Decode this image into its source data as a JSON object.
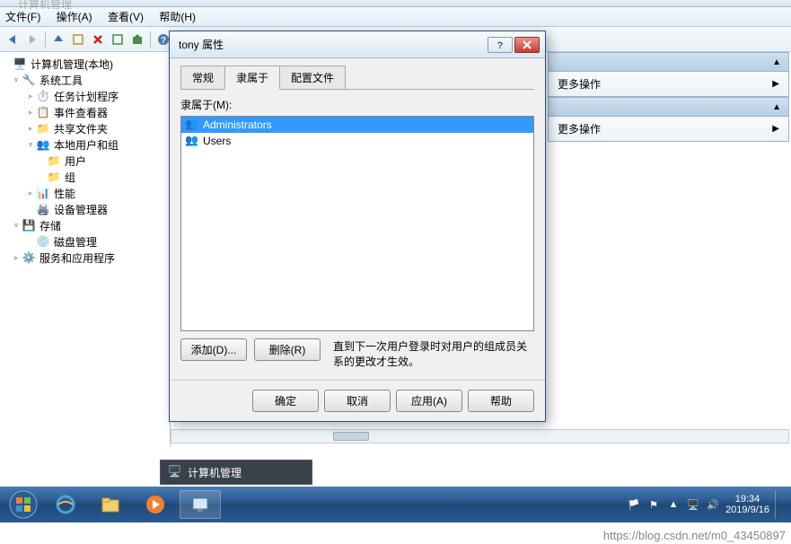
{
  "window_title_fragment": "计算机管理",
  "menu": {
    "file": "文件(F)",
    "action": "操作(A)",
    "view": "查看(V)",
    "help": "帮助(H)"
  },
  "tree": {
    "root": "计算机管理(本地)",
    "system_tools": "系统工具",
    "task_sched": "任务计划程序",
    "event_viewer": "事件查看器",
    "shared_folders": "共享文件夹",
    "local_users_groups": "本地用户和组",
    "users": "用户",
    "groups": "组",
    "performance": "性能",
    "dev_mgr": "设备管理器",
    "storage": "存储",
    "disk_mgmt": "磁盘管理",
    "services_apps": "服务和应用程序"
  },
  "actions_panel": {
    "header1_fragment": "",
    "item1": "更多操作",
    "header2_fragment": "",
    "item2": "更多操作"
  },
  "dialog": {
    "title": "tony 属性",
    "tabs": {
      "general": "常规",
      "member_of": "隶属于",
      "profile": "配置文件"
    },
    "member_of_label": "隶属于(M):",
    "groups": [
      "Administrators",
      "Users"
    ],
    "add_btn": "添加(D)...",
    "remove_btn": "删除(R)",
    "note": "直到下一次用户登录时对用户的组成员关系的更改才生效。",
    "ok": "确定",
    "cancel": "取消",
    "apply": "应用(A)",
    "help": "帮助"
  },
  "preview_title": "计算机管理",
  "tray": {
    "time": "19:34",
    "date": "2019/9/16"
  },
  "watermark": "https://blog.csdn.net/m0_43450897"
}
